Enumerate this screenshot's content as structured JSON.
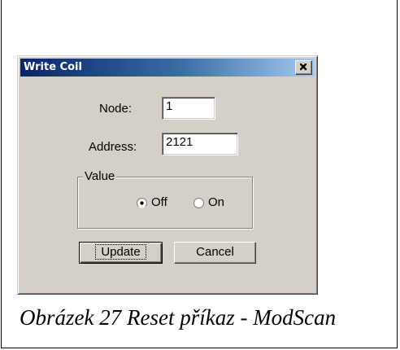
{
  "dialog": {
    "title": "Write Coil",
    "close_icon": "close-icon",
    "node_label": "Node:",
    "node_value": "1",
    "address_label": "Address:",
    "address_value": "2121",
    "value_group_label": "Value",
    "options": [
      {
        "label": "Off",
        "selected": true
      },
      {
        "label": "On",
        "selected": false
      }
    ],
    "update_button": "Update",
    "cancel_button": "Cancel"
  },
  "caption": "Obrázek 27 Reset příkaz - ModScan",
  "colors": {
    "titlebar_start": "#0a246a",
    "titlebar_end": "#a6caf0",
    "dialog_face": "#d4d0c8"
  }
}
